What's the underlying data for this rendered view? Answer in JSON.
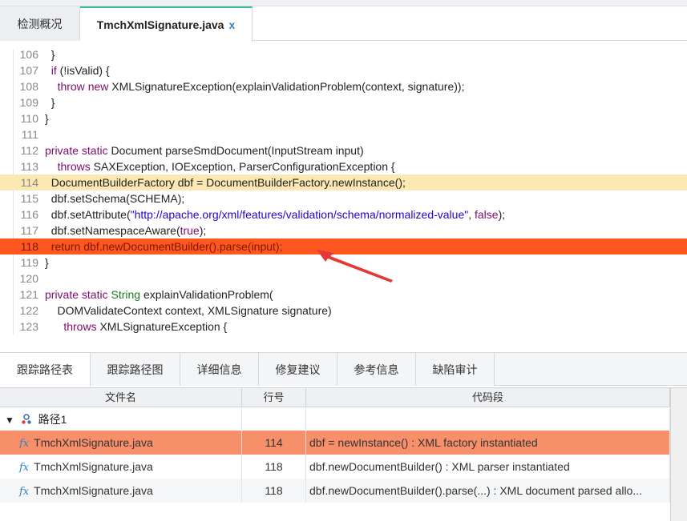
{
  "tabs": [
    {
      "label": "检测概况"
    },
    {
      "label": "TmchXmlSignature.java",
      "close": "x"
    }
  ],
  "code_lines": [
    {
      "num": "106",
      "text": "  }"
    },
    {
      "num": "107",
      "text": "  if (!isValid) {"
    },
    {
      "num": "108",
      "text": "    throw new XMLSignatureException(explainValidationProblem(context, signature));"
    },
    {
      "num": "109",
      "text": "  }"
    },
    {
      "num": "110",
      "text": "}"
    },
    {
      "num": "111",
      "text": ""
    },
    {
      "num": "112",
      "text": "private static Document parseSmdDocument(InputStream input)"
    },
    {
      "num": "113",
      "text": "    throws SAXException, IOException, ParserConfigurationException {"
    },
    {
      "num": "114",
      "text": "  DocumentBuilderFactory dbf = DocumentBuilderFactory.newInstance();"
    },
    {
      "num": "115",
      "text": "  dbf.setSchema(SCHEMA);"
    },
    {
      "num": "116",
      "text": "  dbf.setAttribute(\"http://apache.org/xml/features/validation/schema/normalized-value\", false);"
    },
    {
      "num": "117",
      "text": "  dbf.setNamespaceAware(true);"
    },
    {
      "num": "118",
      "text": "  return dbf.newDocumentBuilder().parse(input);"
    },
    {
      "num": "119",
      "text": "}"
    },
    {
      "num": "120",
      "text": ""
    },
    {
      "num": "121",
      "text": "private static String explainValidationProblem("
    },
    {
      "num": "122",
      "text": "    DOMValidateContext context, XMLSignature signature)"
    },
    {
      "num": "123",
      "text": "      throws XMLSignatureException {"
    }
  ],
  "bottom_tabs": [
    {
      "label": "跟踪路径表"
    },
    {
      "label": "跟踪路径图"
    },
    {
      "label": "详细信息"
    },
    {
      "label": "修复建议"
    },
    {
      "label": "参考信息"
    },
    {
      "label": "缺陷审计"
    }
  ],
  "grid": {
    "headers": {
      "file": "文件名",
      "line": "行号",
      "snippet": "代码段"
    },
    "group_label": "路径1",
    "rows": [
      {
        "file": "TmchXmlSignature.java",
        "line": "114",
        "snippet": "dbf = newInstance() : XML factory instantiated"
      },
      {
        "file": "TmchXmlSignature.java",
        "line": "118",
        "snippet": "dbf.newDocumentBuilder() : XML parser instantiated"
      },
      {
        "file": "TmchXmlSignature.java",
        "line": "118",
        "snippet": "dbf.newDocumentBuilder().parse(...) : XML document parsed allo..."
      }
    ]
  },
  "colors": {
    "highlight_yellow": "#fce8b2",
    "highlight_red": "#ff5722",
    "selected_row": "#f7906a",
    "accent": "#3db89b"
  },
  "icons": {
    "function": "fx-icon",
    "path": "path-node-icon",
    "expand": "triangle-down-icon",
    "arrow": "red-arrow-pointer"
  }
}
